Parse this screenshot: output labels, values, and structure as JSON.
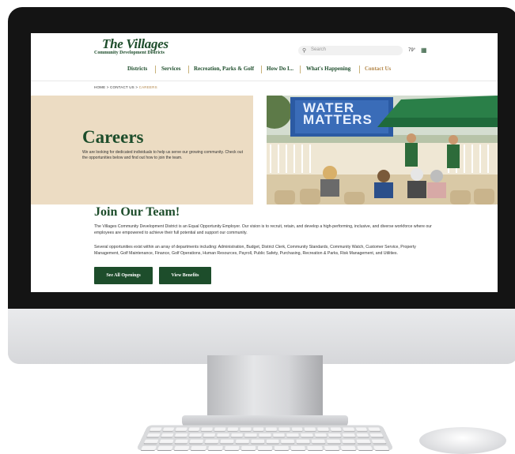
{
  "logo": {
    "title": "The Villages",
    "subtitle": "Community Development Districts"
  },
  "search": {
    "placeholder": "Search"
  },
  "weather": {
    "temp": "79°"
  },
  "nav": {
    "items": [
      "Districts",
      "Services",
      "Recreation, Parks & Golf",
      "How Do I...",
      "What's Happening",
      "Contact Us"
    ]
  },
  "breadcrumb": {
    "home": "HOME",
    "sep1": ">",
    "contact": "CONTACT US",
    "sep2": ">",
    "current": "CAREERS"
  },
  "hero": {
    "title": "Careers",
    "description": "We are looking for dedicated individuals to help us serve our growing community. Check out the opportunities below and find out how to join the team.",
    "banner_text": "WATER MATTERS"
  },
  "join": {
    "title": "Join Our Team!",
    "para1": "The Villages Community Development District is an Equal Opportunity Employer. Our vision is to recruit, retain, and develop a high-performing, inclusive, and diverse workforce where our employees are empowered to achieve their full potential and support our community.",
    "para2": "Several opportunities exist within an array of departments including: Administration, Budget, District Clerk, Community Standards, Community Watch, Customer Service, Property Management, Golf Maintenance, Finance, Golf Operations, Human Resources, Payroll, Public Safety, Purchasing, Recreation & Parks, Risk Management, and Utilities.",
    "btn_openings": "See All Openings",
    "btn_benefits": "View Benefits"
  },
  "colors": {
    "brand_green": "#1d4d2b",
    "accent_gold": "#b3874a",
    "hero_bg": "#ecdcc3"
  }
}
